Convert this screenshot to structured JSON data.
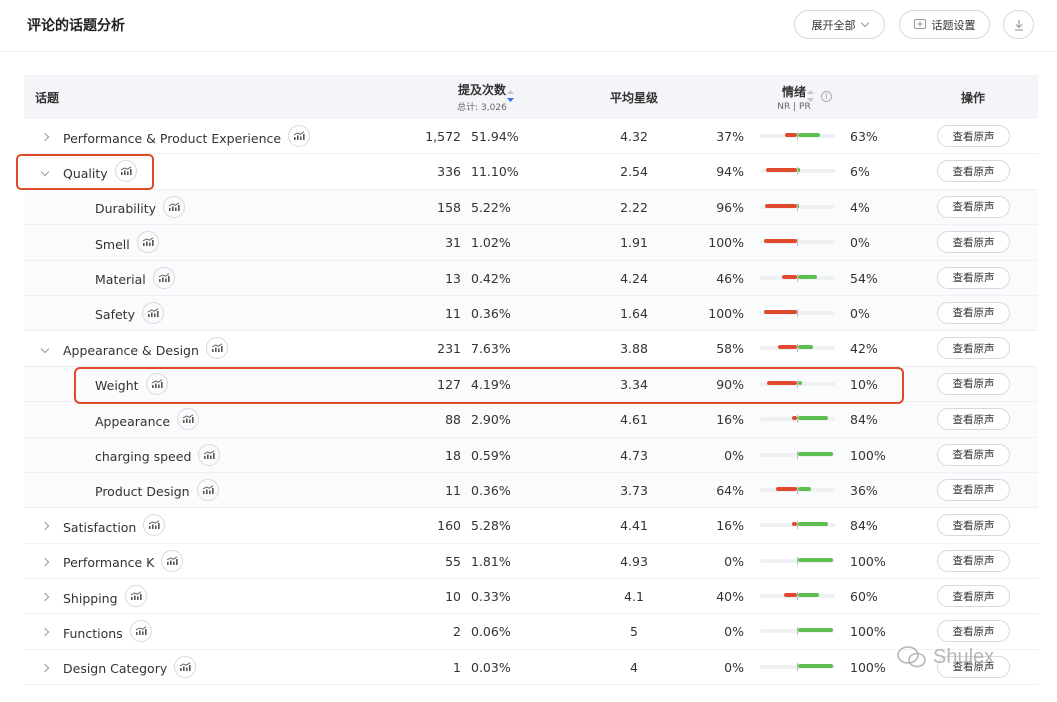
{
  "header": {
    "title": "评论的话题分析",
    "expand_all_label": "展开全部",
    "topic_settings_label": "话题设置"
  },
  "table": {
    "columns": {
      "topic": "话题",
      "mentions": "提及次数",
      "mentions_total": "总计: 3,026",
      "rating": "平均星级",
      "sentiment": "情绪",
      "sentiment_sub": "NR | PR",
      "operation": "操作"
    },
    "view_button_label": "查看原声",
    "rows": [
      {
        "name": "Performance & Product Experience",
        "level": 0,
        "expander": "collapsed",
        "count": "1,572",
        "pct": "51.94%",
        "rating": "4.32",
        "nr": "37%",
        "pr": "63%",
        "nr_value": 37,
        "pr_value": 63
      },
      {
        "name": "Quality",
        "level": 0,
        "expander": "expanded",
        "count": "336",
        "pct": "11.10%",
        "rating": "2.54",
        "nr": "94%",
        "pr": "6%",
        "nr_value": 94,
        "pr_value": 6
      },
      {
        "name": "Durability",
        "level": 1,
        "expander": "none",
        "count": "158",
        "pct": "5.22%",
        "rating": "2.22",
        "nr": "96%",
        "pr": "4%",
        "nr_value": 96,
        "pr_value": 4
      },
      {
        "name": "Smell",
        "level": 1,
        "expander": "none",
        "count": "31",
        "pct": "1.02%",
        "rating": "1.91",
        "nr": "100%",
        "pr": "0%",
        "nr_value": 100,
        "pr_value": 0
      },
      {
        "name": "Material",
        "level": 1,
        "expander": "none",
        "count": "13",
        "pct": "0.42%",
        "rating": "4.24",
        "nr": "46%",
        "pr": "54%",
        "nr_value": 46,
        "pr_value": 54
      },
      {
        "name": "Safety",
        "level": 1,
        "expander": "none",
        "count": "11",
        "pct": "0.36%",
        "rating": "1.64",
        "nr": "100%",
        "pr": "0%",
        "nr_value": 100,
        "pr_value": 0
      },
      {
        "name": "Appearance & Design",
        "level": 0,
        "expander": "expanded",
        "count": "231",
        "pct": "7.63%",
        "rating": "3.88",
        "nr": "58%",
        "pr": "42%",
        "nr_value": 58,
        "pr_value": 42
      },
      {
        "name": "Weight",
        "level": 1,
        "expander": "none",
        "count": "127",
        "pct": "4.19%",
        "rating": "3.34",
        "nr": "90%",
        "pr": "10%",
        "nr_value": 90,
        "pr_value": 10
      },
      {
        "name": "Appearance",
        "level": 1,
        "expander": "none",
        "count": "88",
        "pct": "2.90%",
        "rating": "4.61",
        "nr": "16%",
        "pr": "84%",
        "nr_value": 16,
        "pr_value": 84
      },
      {
        "name": "charging speed",
        "level": 1,
        "expander": "none",
        "count": "18",
        "pct": "0.59%",
        "rating": "4.73",
        "nr": "0%",
        "pr": "100%",
        "nr_value": 0,
        "pr_value": 100
      },
      {
        "name": "Product Design",
        "level": 1,
        "expander": "none",
        "count": "11",
        "pct": "0.36%",
        "rating": "3.73",
        "nr": "64%",
        "pr": "36%",
        "nr_value": 64,
        "pr_value": 36
      },
      {
        "name": "Satisfaction",
        "level": 0,
        "expander": "collapsed",
        "count": "160",
        "pct": "5.28%",
        "rating": "4.41",
        "nr": "16%",
        "pr": "84%",
        "nr_value": 16,
        "pr_value": 84
      },
      {
        "name": "Performance K",
        "level": 0,
        "expander": "collapsed",
        "count": "55",
        "pct": "1.81%",
        "rating": "4.93",
        "nr": "0%",
        "pr": "100%",
        "nr_value": 0,
        "pr_value": 100
      },
      {
        "name": "Shipping",
        "level": 0,
        "expander": "collapsed",
        "count": "10",
        "pct": "0.33%",
        "rating": "4.1",
        "nr": "40%",
        "pr": "60%",
        "nr_value": 40,
        "pr_value": 60
      },
      {
        "name": "Functions",
        "level": 0,
        "expander": "collapsed",
        "count": "2",
        "pct": "0.06%",
        "rating": "5",
        "nr": "0%",
        "pr": "100%",
        "nr_value": 0,
        "pr_value": 100
      },
      {
        "name": "Design Category",
        "level": 0,
        "expander": "collapsed",
        "count": "1",
        "pct": "0.03%",
        "rating": "4",
        "nr": "0%",
        "pr": "100%",
        "nr_value": 0,
        "pr_value": 100
      }
    ]
  },
  "colors": {
    "negative": "#e0492b",
    "positive": "#5cbf4f",
    "highlight": "#e0492b",
    "sort_active": "#3b6fe0"
  },
  "watermark": {
    "text": "Shulex"
  }
}
